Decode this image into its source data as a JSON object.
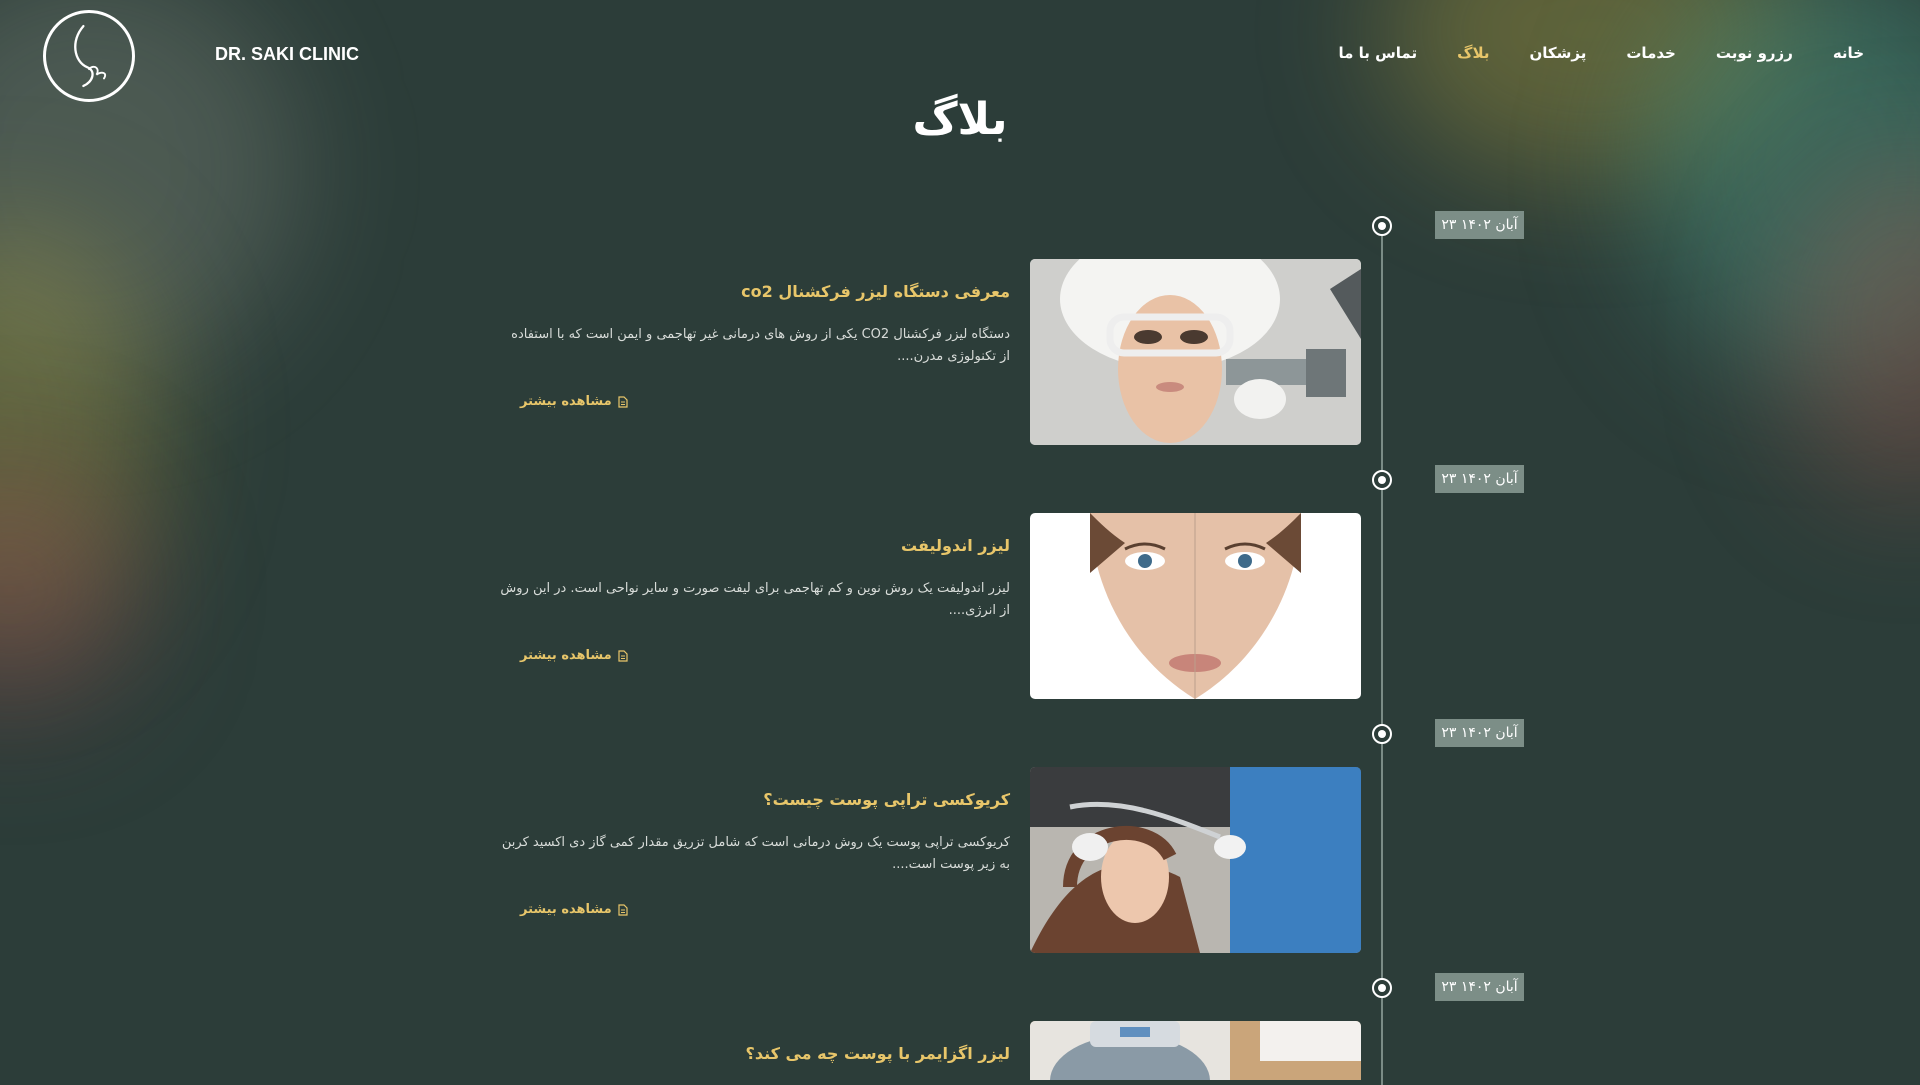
{
  "brand": {
    "name": "DR. SAKI CLINIC"
  },
  "nav": {
    "items": [
      {
        "label": "خانه",
        "active": false
      },
      {
        "label": "رزرو نوبت",
        "active": false
      },
      {
        "label": "خدمات",
        "active": false
      },
      {
        "label": "پزشکان",
        "active": false
      },
      {
        "label": "بلاگ",
        "active": true
      },
      {
        "label": "تماس با ما",
        "active": false
      }
    ]
  },
  "page": {
    "title": "بلاگ"
  },
  "posts": [
    {
      "date": "۲۳ آبان ۱۴۰۲",
      "title": "معرفی دستگاه لیزر فرکشنال co2",
      "excerpt": "دستگاه لیزر فرکشنال CO2 یکی از روش های درمانی غیر تهاجمی و ایمن است که با استفاده از تکنولوژی مدرن....",
      "read_more": "مشاهده بیشتر"
    },
    {
      "date": "۲۳ آبان ۱۴۰۲",
      "title": "لیزر اندولیفت",
      "excerpt": "لیزر اندولیفت یک روش نوین و کم تهاجمی برای لیفت صورت و سایر نواحی است. در این روش از انرژی....",
      "read_more": "مشاهده بیشتر"
    },
    {
      "date": "۲۳ آبان ۱۴۰۲",
      "title": "کریوکسی تراپی پوست چیست؟",
      "excerpt": "کریوکسی تراپی پوست یک روش درمانی است که شامل تزریق مقدار کمی گاز دی اکسید کربن به زیر پوست است....",
      "read_more": "مشاهده بیشتر"
    },
    {
      "date": "۲۳ آبان ۱۴۰۲",
      "title": "لیزر اگزایمر با پوست چه می کند؟"
    }
  ],
  "colors": {
    "background": "#2c3d39",
    "accent": "#e8c66a",
    "badge": "#7c8e87"
  }
}
